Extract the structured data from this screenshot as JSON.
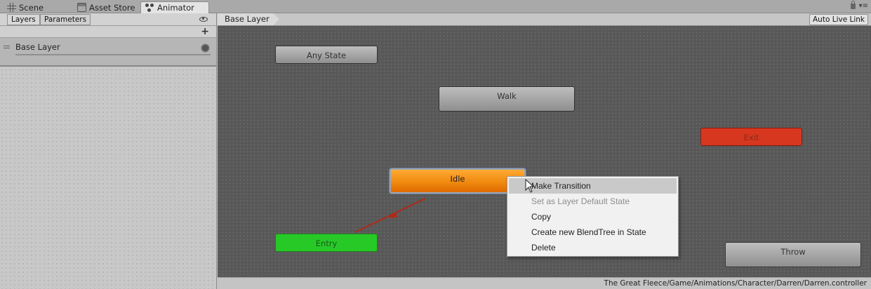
{
  "tabs": [
    {
      "label": "Scene",
      "icon": "grid-icon"
    },
    {
      "label": "Asset Store",
      "icon": "store-icon"
    },
    {
      "label": "Animator",
      "icon": "animator-icon",
      "active": true
    }
  ],
  "left_panel": {
    "tabs": [
      "Layers",
      "Parameters"
    ],
    "add_label": "+",
    "layers": [
      {
        "name": "Base Layer"
      }
    ]
  },
  "graph": {
    "breadcrumb": "Base Layer",
    "auto_live_link": "Auto Live Link",
    "states": [
      {
        "name": "Any State",
        "color": "#a8a8a8"
      },
      {
        "name": "Walk",
        "color": "#a8a8a8"
      },
      {
        "name": "Exit",
        "color": "#d8371f"
      },
      {
        "name": "Idle",
        "color": "#f08a10",
        "default": true
      },
      {
        "name": "Entry",
        "color": "#27c927"
      },
      {
        "name": "Throw",
        "color": "#a8a8a8"
      }
    ]
  },
  "context_menu": {
    "items": [
      {
        "label": "Make Transition",
        "state": "hover"
      },
      {
        "label": "Set as Layer Default State",
        "state": "disabled"
      },
      {
        "label": "Copy",
        "state": "normal"
      },
      {
        "label": "Create new BlendTree in State",
        "state": "normal"
      },
      {
        "label": "Delete",
        "state": "normal"
      }
    ]
  },
  "status_bar": {
    "path": "The Great Fleece/Game/Animations/Character/Darren/Darren.controller"
  }
}
